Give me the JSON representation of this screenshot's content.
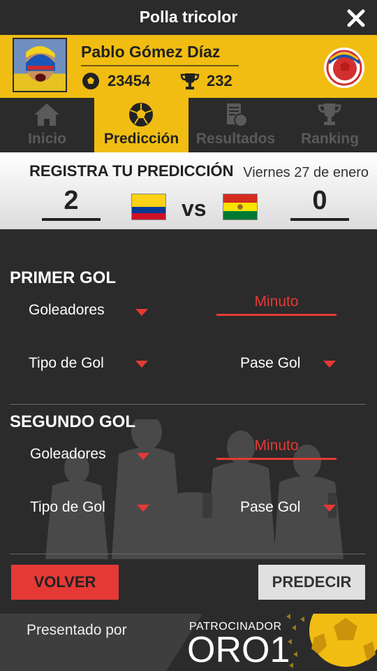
{
  "header": {
    "title": "Polla tricolor",
    "close_icon": "close-icon"
  },
  "profile": {
    "name": "Pablo Gómez Díaz",
    "coins": "23454",
    "trophies": "232",
    "accent_color": "#f1bd12"
  },
  "tabs": [
    {
      "label": "Inicio",
      "icon": "home-icon",
      "active": false
    },
    {
      "label": "Predicción",
      "icon": "soccer-ball-icon",
      "active": true
    },
    {
      "label": "Resultados",
      "icon": "document-icon",
      "active": false
    },
    {
      "label": "Ranking",
      "icon": "trophy-icon",
      "active": false
    }
  ],
  "match": {
    "title": "REGISTRA TU PREDICCIÓN",
    "date": "Viernes 27 de enero",
    "home_score": "2",
    "away_score": "0",
    "vs": "vs"
  },
  "first_goal": {
    "title": "PRIMER GOL",
    "scorers": "Goleadores",
    "minute": "Minuto",
    "goal_type": "Tipo de Gol",
    "assist": "Pase Gol"
  },
  "second_goal": {
    "title": "SEGUNDO GOL",
    "scorers": "Goleadores",
    "minute": "Minuto",
    "goal_type": "Tipo de Gol",
    "assist": "Pase Gol"
  },
  "actions": {
    "back": "VOLVER",
    "predict": "PREDECIR"
  },
  "footer": {
    "presented_by": "Presentado por",
    "sponsor_tier": "PATROCINADOR",
    "sponsor_name": "ORO1"
  },
  "colors": {
    "accent": "#f1bd12",
    "danger": "#e53935",
    "dark": "#2b2b2b"
  }
}
